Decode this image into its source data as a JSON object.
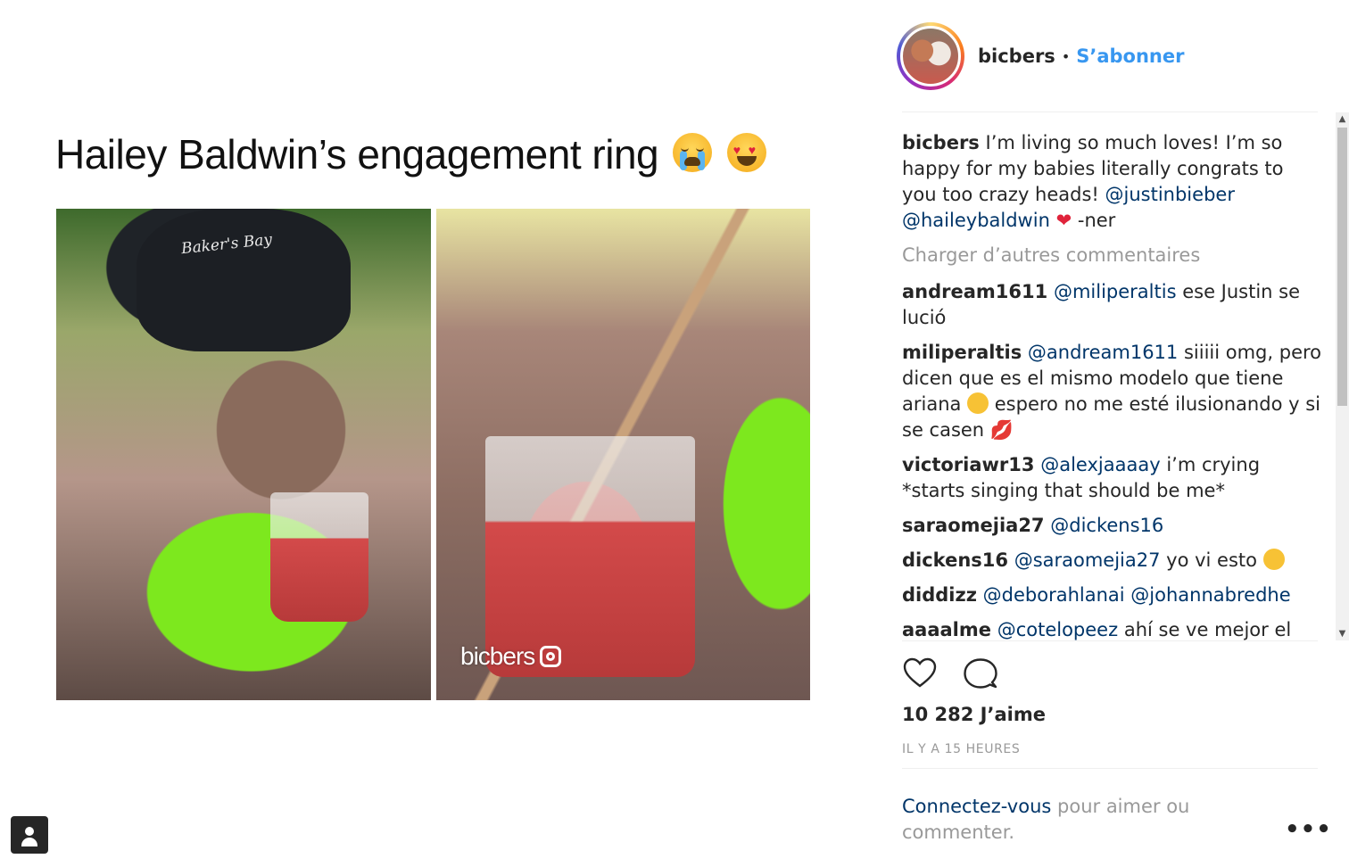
{
  "post": {
    "title": "Hailey Baldwin’s engagement ring",
    "cap_text": "Baker's Bay",
    "watermark": "bicbers"
  },
  "header": {
    "username": "bicbers",
    "separator": "•",
    "follow_label": "S’abonner"
  },
  "caption": {
    "username": "bicbers",
    "text": "I’m living so much loves! I’m so happy for my babies literally congrats to you too crazy heads!",
    "mention_1": "@justinbieber",
    "mention_2": "@haileybaldwin",
    "tail": "-ner"
  },
  "load_more_label": "Charger d’autres commentaires",
  "comments": [
    {
      "user": "andream1611",
      "mention": "@miliperaltis",
      "text": "ese Justin se lució"
    },
    {
      "user": "miliperaltis",
      "mention": "@andream1611",
      "text": "siiiii omg, pero dicen que es el mismo modelo que tiene ariana",
      "text2": "espero no me esté ilusionando y si se casen"
    },
    {
      "user": "victoriawr13",
      "mention": "@alexjaaaay",
      "text": "i’m crying *starts singing that should be me*"
    },
    {
      "user": "saraomejia27",
      "mention": "@dickens16",
      "text": ""
    },
    {
      "user": "dickens16",
      "mention": "@saraomejia27",
      "text": "yo vi esto"
    },
    {
      "user": "diddizz",
      "mention": "@deborahlanai",
      "mention2": "@johannabredhe",
      "text": ""
    },
    {
      "user": "aaaalme",
      "mention": "@cotelopeez",
      "text": "ahí se ve mejor el"
    }
  ],
  "likes": "10 282 J’aime",
  "timestamp": "IL Y A 15 HEURES",
  "login": {
    "link": "Connectez-vous",
    "text": "pour aimer ou commenter."
  },
  "more_label": "•••",
  "icons": [
    "heart-icon",
    "comment-icon",
    "more-options-icon",
    "user-icon",
    "instagram-icon"
  ],
  "colors": {
    "link_blue": "#3897f0",
    "mention_blue": "#003569",
    "muted": "#999999"
  }
}
